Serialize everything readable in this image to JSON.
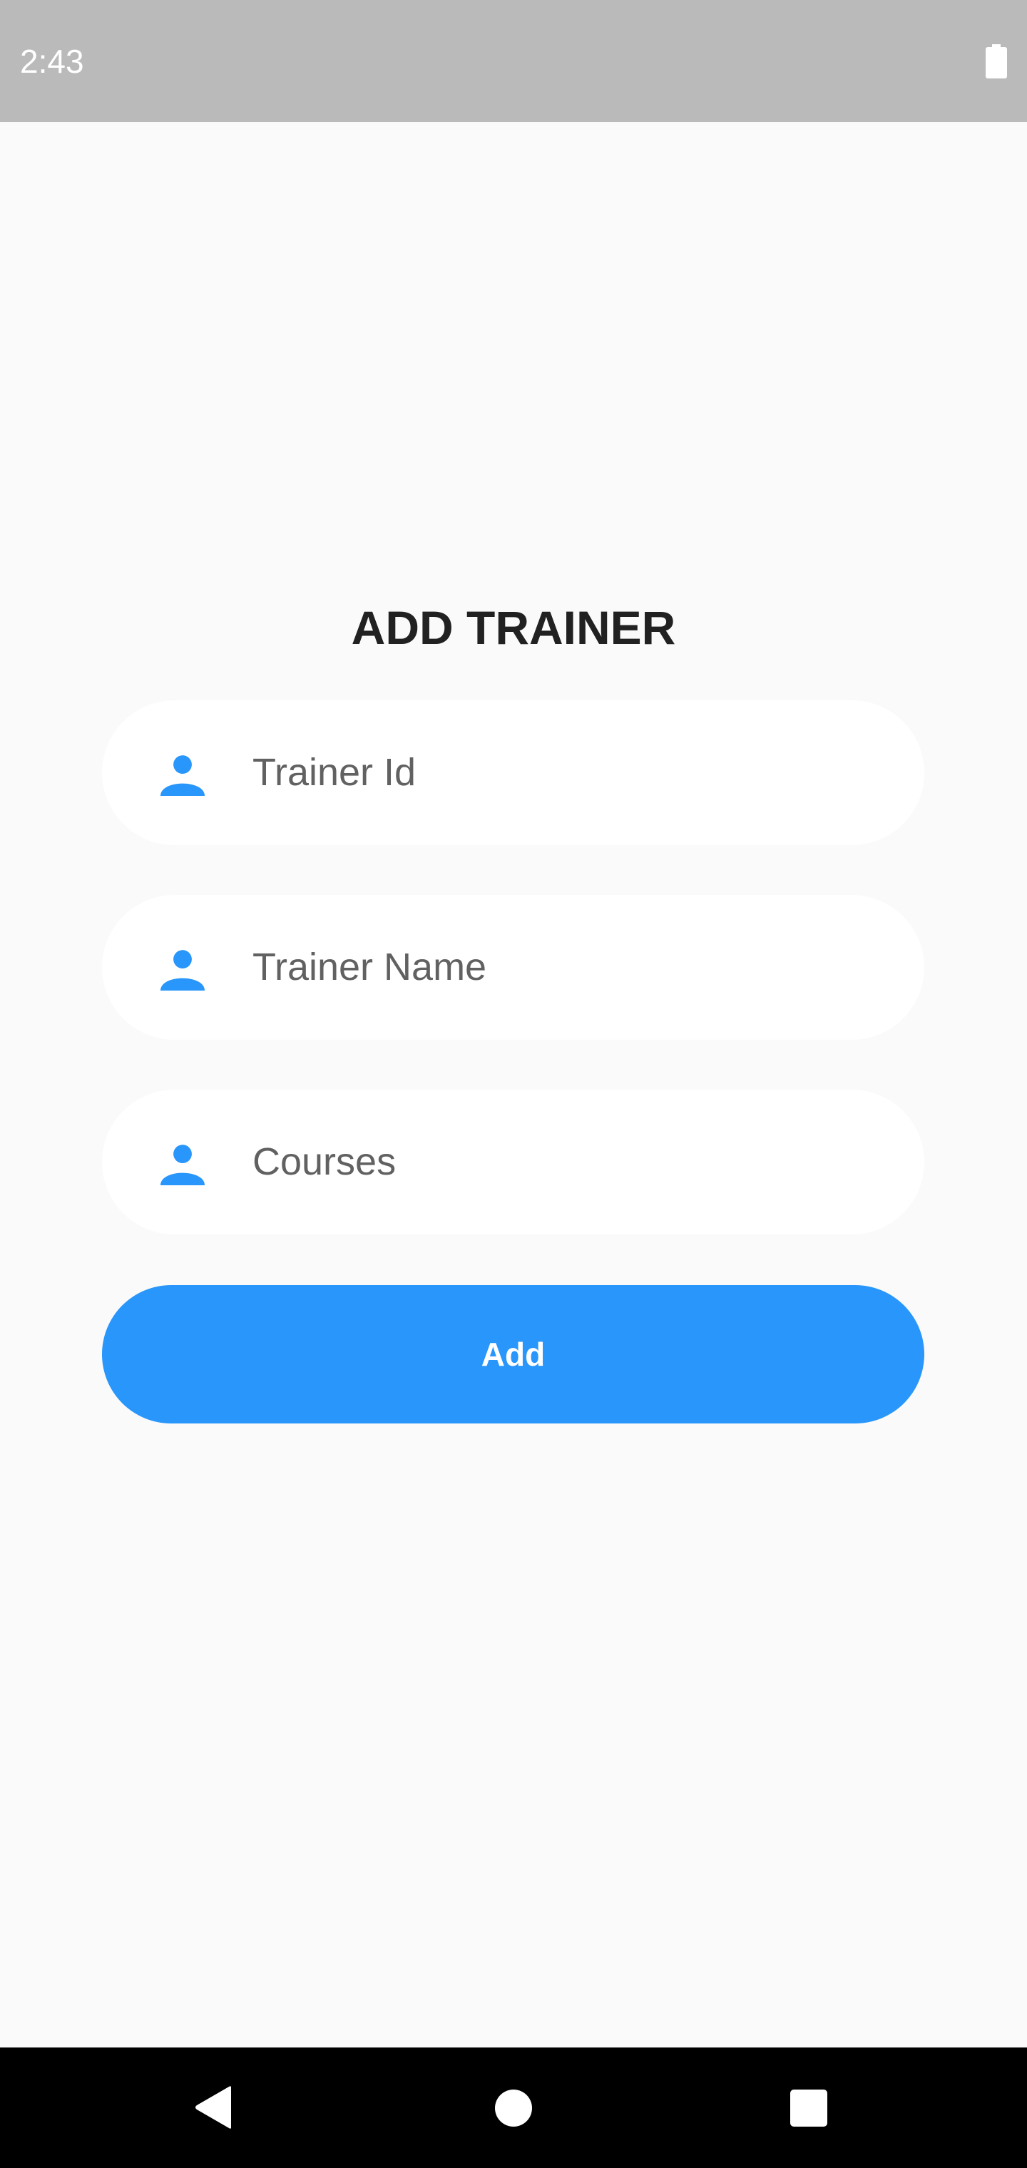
{
  "status_bar": {
    "time": "2:43",
    "battery_icon": "battery-full-icon"
  },
  "form": {
    "title": "ADD TRAINER",
    "fields": [
      {
        "icon": "person-icon",
        "placeholder": "Trainer Id"
      },
      {
        "icon": "person-icon",
        "placeholder": "Trainer Name"
      },
      {
        "icon": "person-icon",
        "placeholder": "Courses"
      }
    ],
    "submit_label": "Add"
  },
  "nav_bar": {
    "back_icon": "back-triangle-icon",
    "home_icon": "home-circle-icon",
    "recents_icon": "recents-square-icon"
  },
  "colors": {
    "accent": "#2896fb",
    "background": "#fafafa",
    "status_bar": "#bababa",
    "field_background": "#ffffff",
    "title_text": "#212121",
    "placeholder_text": "#616161"
  }
}
